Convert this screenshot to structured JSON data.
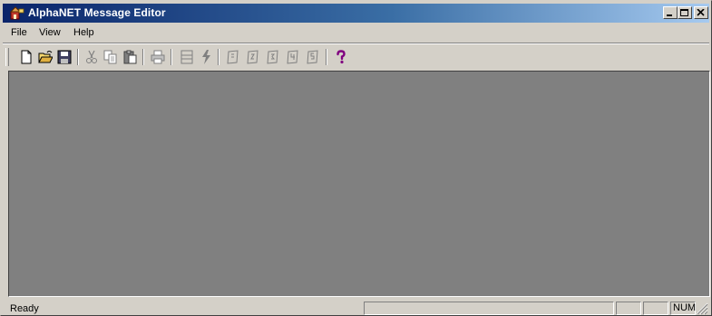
{
  "window": {
    "title": "AlphaNET Message Editor"
  },
  "menubar": {
    "items": [
      "File",
      "View",
      "Help"
    ]
  },
  "toolbar": {
    "buttons": [
      "new-icon",
      "open-icon",
      "save-icon",
      "cut-icon",
      "copy-icon",
      "paste-icon",
      "print-icon",
      "sign-settings-icon",
      "send-icon",
      "message-1-icon",
      "message-2-icon",
      "message-3-icon",
      "message-4-icon",
      "message-5-icon",
      "help-icon"
    ]
  },
  "statusbar": {
    "status": "Ready",
    "num_indicator": "NUM"
  },
  "colors": {
    "titlebar_start": "#0a246a",
    "titlebar_end": "#a6caf0",
    "client_bg": "#808080",
    "chrome_bg": "#d4d0c8",
    "help_icon": "#800080"
  }
}
